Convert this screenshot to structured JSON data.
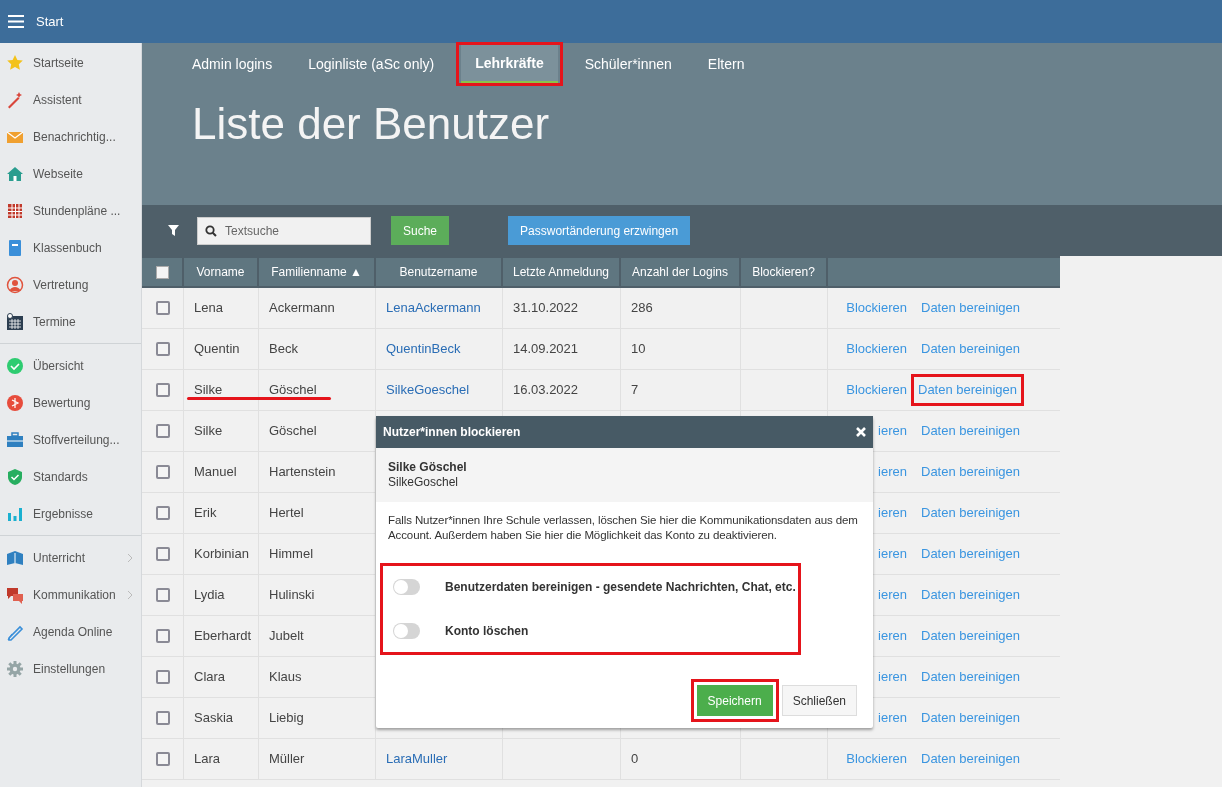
{
  "top_bar": {
    "title": "Start"
  },
  "sidebar": {
    "sections": [
      {
        "items": [
          {
            "label": "Startseite",
            "expandable": false
          },
          {
            "label": "Assistent",
            "expandable": false
          },
          {
            "label": "Benachrichtig...",
            "expandable": false
          },
          {
            "label": "Webseite",
            "expandable": false
          },
          {
            "label": "Stundenpläne ...",
            "expandable": false
          },
          {
            "label": "Klassenbuch",
            "expandable": false
          },
          {
            "label": "Vertretung",
            "expandable": false
          },
          {
            "label": "Termine",
            "expandable": false
          }
        ]
      },
      {
        "items": [
          {
            "label": "Übersicht",
            "expandable": false
          },
          {
            "label": "Bewertung",
            "expandable": false
          },
          {
            "label": "Stoffverteilung...",
            "expandable": false
          },
          {
            "label": "Standards",
            "expandable": false
          },
          {
            "label": "Ergebnisse",
            "expandable": false
          }
        ]
      },
      {
        "items": [
          {
            "label": "Unterricht",
            "expandable": true
          },
          {
            "label": "Kommunikation",
            "expandable": true
          },
          {
            "label": "Agenda Online",
            "expandable": false
          },
          {
            "label": "Einstellungen",
            "expandable": false
          }
        ]
      }
    ]
  },
  "tabs": [
    {
      "label": "Admin logins",
      "selected": false,
      "highlighted": false
    },
    {
      "label": "Loginliste (aSc only)",
      "selected": false,
      "highlighted": false
    },
    {
      "label": "Lehrkräfte",
      "selected": true,
      "highlighted": true
    },
    {
      "label": "Schüler*innen",
      "selected": false,
      "highlighted": false
    },
    {
      "label": "Eltern",
      "selected": false,
      "highlighted": false
    }
  ],
  "title": "Liste der Benutzer",
  "toolbar": {
    "search": {
      "placeholder": "Textsuche"
    },
    "search_button": "Suche",
    "force_button": "Passwortänderung erzwingen"
  },
  "table": {
    "select_all": {
      "checked": false
    },
    "columns": [
      "Vorname",
      "Familienname ▲",
      "Benutzername",
      "Letzte Anmeldung",
      "Anzahl der Logins",
      "Blockieren?"
    ],
    "rows": [
      {
        "checked": false,
        "first_name": "Lena",
        "last_name": "Ackermann",
        "username": "LenaAckermann",
        "last_login": "31.10.2022",
        "logins": "286",
        "block_link": "Blockieren",
        "clean_link": "Daten bereinigen",
        "clean_highlighted": false,
        "underlined": false
      },
      {
        "checked": false,
        "first_name": "Quentin",
        "last_name": "Beck",
        "username": "QuentinBeck",
        "last_login": "14.09.2021",
        "logins": "10",
        "block_link": "Blockieren",
        "clean_link": "Daten bereinigen",
        "clean_highlighted": false,
        "underlined": false
      },
      {
        "checked": false,
        "first_name": "Silke",
        "last_name": "Göschel",
        "username": "SilkeGoeschel",
        "last_login": "16.03.2022",
        "logins": "7",
        "block_link": "Blockieren",
        "clean_link": "Daten bereinigen",
        "clean_highlighted": true,
        "underlined": true
      },
      {
        "checked": false,
        "first_name": "Silke",
        "last_name": "Göschel",
        "block_link": "ieren",
        "clean_link": "Daten bereinigen",
        "clean_highlighted": false,
        "underlined": false
      },
      {
        "checked": false,
        "first_name": "Manuel",
        "last_name": "Hartenstein",
        "block_link": "ieren",
        "clean_link": "Daten bereinigen",
        "clean_highlighted": false,
        "underlined": false
      },
      {
        "checked": false,
        "first_name": "Erik",
        "last_name": "Hertel",
        "block_link": "ieren",
        "clean_link": "Daten bereinigen",
        "clean_highlighted": false,
        "underlined": false
      },
      {
        "checked": false,
        "first_name": "Korbinian",
        "last_name": "Himmel",
        "block_link": "ieren",
        "clean_link": "Daten bereinigen",
        "clean_highlighted": false,
        "underlined": false
      },
      {
        "checked": false,
        "first_name": "Lydia",
        "last_name": "Hulinski",
        "block_link": "ieren",
        "clean_link": "Daten bereinigen",
        "clean_highlighted": false,
        "underlined": false
      },
      {
        "checked": false,
        "first_name": "Eberhardt",
        "last_name": "Jubelt",
        "block_link": "ieren",
        "clean_link": "Daten bereinigen",
        "clean_highlighted": false,
        "underlined": false
      },
      {
        "checked": false,
        "first_name": "Clara",
        "last_name": "Klaus",
        "block_link": "ieren",
        "clean_link": "Daten bereinigen",
        "clean_highlighted": false,
        "underlined": false
      },
      {
        "checked": false,
        "first_name": "Saskia",
        "last_name": "Liebig",
        "block_link": "ieren",
        "clean_link": "Daten bereinigen",
        "clean_highlighted": false,
        "underlined": false
      },
      {
        "checked": false,
        "first_name": "Lara",
        "last_name": "Müller",
        "username": "LaraMuller",
        "logins": "0",
        "block_link": "Blockieren",
        "clean_link": "Daten bereinigen",
        "clean_highlighted": false,
        "underlined": false
      }
    ]
  },
  "dialog": {
    "title": "Nutzer*innen blockieren",
    "user_name": "Silke Göschel",
    "user_login": "SilkeGoschel",
    "description": "Falls Nutzer*innen Ihre Schule verlassen, löschen Sie hier die Kommunikationsdaten aus dem Account. Außerdem haben Sie hier die Möglichkeit das Konto zu deaktivieren.",
    "options_highlighted": true,
    "toggles": [
      {
        "label": "Benutzerdaten bereinigen - gesendete Nachrichten, Chat, etc.",
        "on": false
      },
      {
        "label": "Konto löschen",
        "on": false
      }
    ],
    "save_button": {
      "label": "Speichern",
      "highlighted": true
    },
    "close_button": "Schließen"
  }
}
